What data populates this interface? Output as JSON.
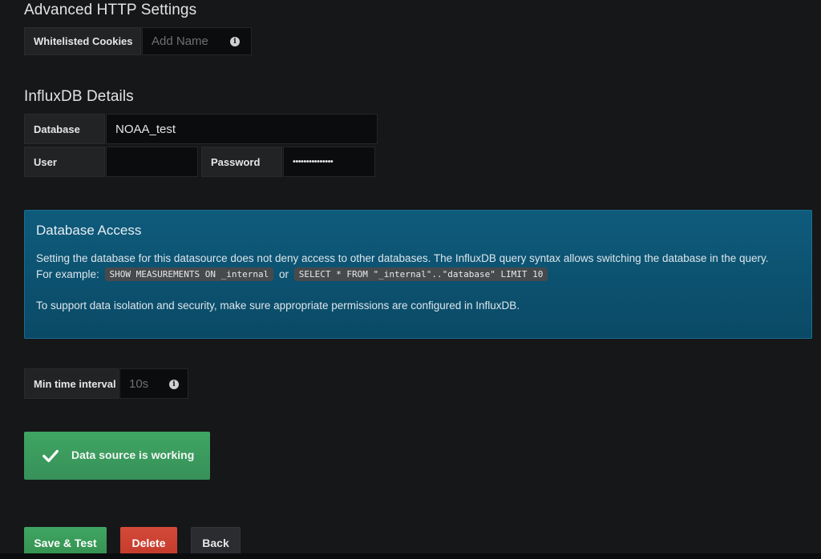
{
  "advanced_http": {
    "title": "Advanced HTTP Settings",
    "whitelisted_cookies_label": "Whitelisted Cookies",
    "whitelisted_cookies_placeholder": "Add Name"
  },
  "influxdb": {
    "title": "InfluxDB Details",
    "database_label": "Database",
    "database_value": "NOAA_test",
    "user_label": "User",
    "user_value": "",
    "password_label": "Password",
    "password_value": "•••••••••••••••"
  },
  "database_access": {
    "title": "Database Access",
    "line1": "Setting the database for this datasource does not deny access to other databases. The InfluxDB query syntax allows switching the database in the query.",
    "for_example": "For example:",
    "code1": "SHOW MEASUREMENTS ON _internal",
    "or": "or",
    "code2": "SELECT * FROM \"_internal\"..\"database\" LIMIT 10",
    "line3": "To support data isolation and security, make sure appropriate permissions are configured in InfluxDB."
  },
  "min_time_interval": {
    "label": "Min time interval",
    "placeholder": "10s"
  },
  "status": {
    "message": "Data source is working",
    "icon": "check-icon"
  },
  "buttons": {
    "save_test": "Save & Test",
    "delete": "Delete",
    "back": "Back"
  },
  "colors": {
    "success": "#3fa562",
    "danger": "#d44a3a",
    "info_panel": "#0f5b7c"
  }
}
